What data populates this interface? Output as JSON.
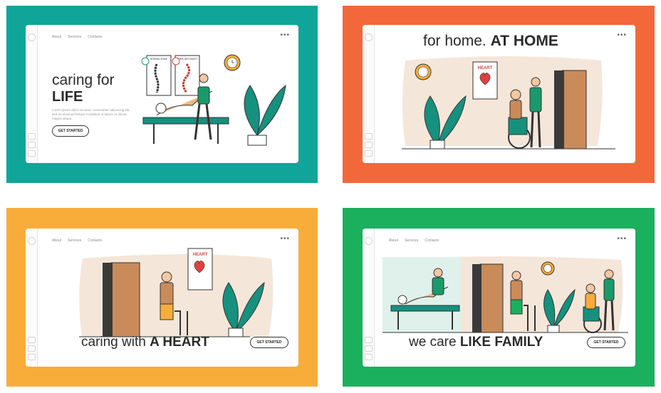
{
  "colors": {
    "teal": "#0fa599",
    "orange": "#f2683a",
    "yellow": "#f8ad3b",
    "green": "#1ab05e",
    "bed": "#15917e",
    "blob": "#f5e6da"
  },
  "nav": {
    "about": "About",
    "services": "Services",
    "contacts": "Contacts"
  },
  "more_icon": "•••",
  "panels": [
    {
      "title_light": "caring for",
      "title_bold": "LIFE",
      "button": "GET STARTED",
      "posters": {
        "normal": "NORMAL SPINE",
        "deformity": "SPINE DEFORMITY"
      },
      "description": "Lorem ipsum dolor sit amet, consectetur adipiscing elit, sed do eiusmod tempor incididunt ut labore et dolore magna aliqua."
    },
    {
      "title_light": "for home.",
      "title_bold": "AT HOME",
      "poster": "HEART"
    },
    {
      "title_light": "caring with",
      "title_bold": "A HEART",
      "button": "GET STARTED",
      "poster": "HEART"
    },
    {
      "title_light": "we care",
      "title_bold": "LIKE FAMILY",
      "button": "GET STARTED"
    }
  ]
}
